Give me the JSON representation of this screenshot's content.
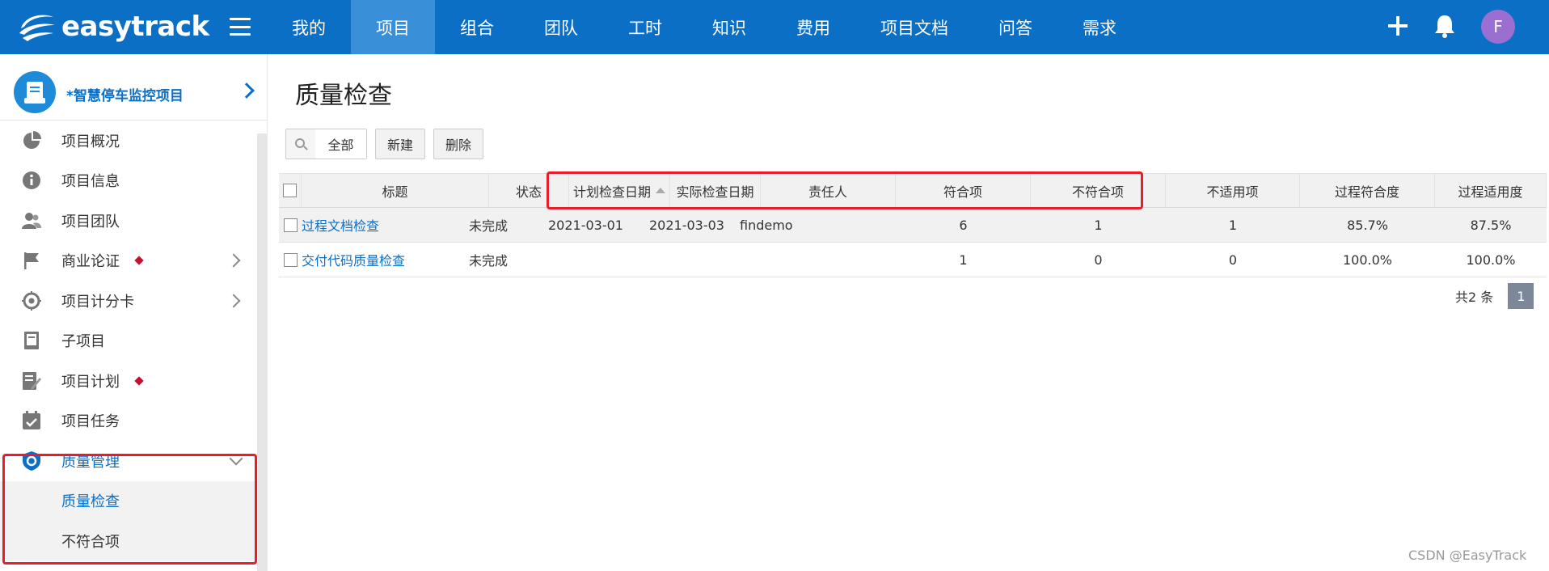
{
  "app": {
    "logo_text": "easytrack"
  },
  "nav": {
    "items": [
      {
        "label": "我的"
      },
      {
        "label": "项目",
        "active": true
      },
      {
        "label": "组合"
      },
      {
        "label": "团队"
      },
      {
        "label": "工时"
      },
      {
        "label": "知识"
      },
      {
        "label": "费用"
      },
      {
        "label": "项目文档"
      },
      {
        "label": "问答"
      },
      {
        "label": "需求"
      }
    ],
    "avatar_letter": "F"
  },
  "sidebar": {
    "project_name": "*智慧停车监控项目",
    "items": [
      {
        "label": "项目概况",
        "icon": "pie-chart-icon"
      },
      {
        "label": "项目信息",
        "icon": "info-icon"
      },
      {
        "label": "项目团队",
        "icon": "team-icon"
      },
      {
        "label": "商业论证",
        "icon": "flag-icon",
        "dot": true,
        "arrow": true
      },
      {
        "label": "项目计分卡",
        "icon": "target-icon",
        "arrow": true
      },
      {
        "label": "子项目",
        "icon": "book-icon"
      },
      {
        "label": "项目计划",
        "icon": "plan-icon",
        "dot": true
      },
      {
        "label": "项目任务",
        "icon": "calendar-check-icon"
      },
      {
        "label": "质量管理",
        "icon": "shield-icon",
        "active": true,
        "expanded": true
      }
    ],
    "submenu": [
      {
        "label": "质量检查",
        "active": true
      },
      {
        "label": "不符合项"
      }
    ]
  },
  "main": {
    "title": "质量检查",
    "filter_label": "全部",
    "new_label": "新建",
    "delete_label": "删除"
  },
  "grid": {
    "columns": [
      "标题",
      "状态",
      "计划检查日期",
      "实际检查日期",
      "责任人",
      "符合项",
      "不符合项",
      "不适用项",
      "过程符合度",
      "过程适用度"
    ],
    "rows": [
      {
        "title": "过程文档检查",
        "status": "未完成",
        "planned": "2021-03-01",
        "actual": "2021-03-03",
        "owner": "findemo",
        "conform": "6",
        "nonconform": "1",
        "na": "1",
        "process_conformity": "85.7%",
        "process_applicability": "87.5%"
      },
      {
        "title": "交付代码质量检查",
        "status": "未完成",
        "planned": "",
        "actual": "",
        "owner": "",
        "conform": "1",
        "nonconform": "0",
        "na": "0",
        "process_conformity": "100.0%",
        "process_applicability": "100.0%"
      }
    ]
  },
  "pager": {
    "total": "共2 条",
    "page": "1"
  },
  "watermark": "CSDN @EasyTrack",
  "colors": {
    "brand": "#0b6fc6",
    "highlight": "#e81d2a"
  }
}
